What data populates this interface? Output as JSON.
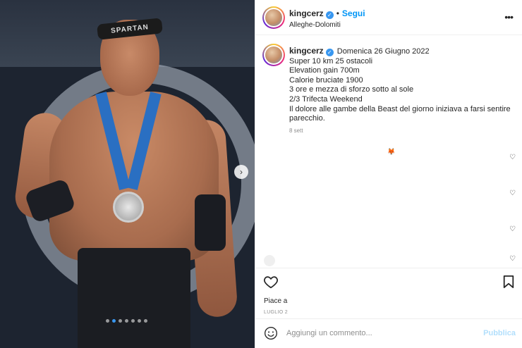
{
  "photo": {
    "headband_text": "SPARTAN",
    "carousel_next_icon": "chevron-right-icon",
    "dots_count": 7,
    "active_dot": 1
  },
  "header": {
    "username": "kingcerz",
    "separator": "•",
    "follow_label": "Segui",
    "location": "Alleghe-Dolomiti",
    "more_icon": "more-horizontal-icon"
  },
  "caption": {
    "username": "kingcerz",
    "date": "Domenica 26 Giugno 2022",
    "lines": [
      "Super 10 km 25 ostacoli",
      "Elevation gain 700m",
      "Calorie bruciate 1900",
      "3 ore e mezza di sforzo sotto al sole",
      "2/3 Trifecta Weekend",
      "Il dolore alle gambe della Beast del giorno iniziava a farsi sentire parecchio."
    ],
    "time": "8 sett"
  },
  "actions": {
    "like_icon": "heart-icon",
    "save_icon": "bookmark-icon",
    "likes_text": "Piace a",
    "post_date": "LUGLIO 2"
  },
  "add_comment": {
    "emoji_icon": "emoji-icon",
    "placeholder": "Aggiungi un commento...",
    "publish_label": "Pubblica"
  },
  "colors": {
    "link_blue": "#0095f6",
    "publish_disabled": "#b2dffc",
    "verified_blue": "#3897f0"
  }
}
